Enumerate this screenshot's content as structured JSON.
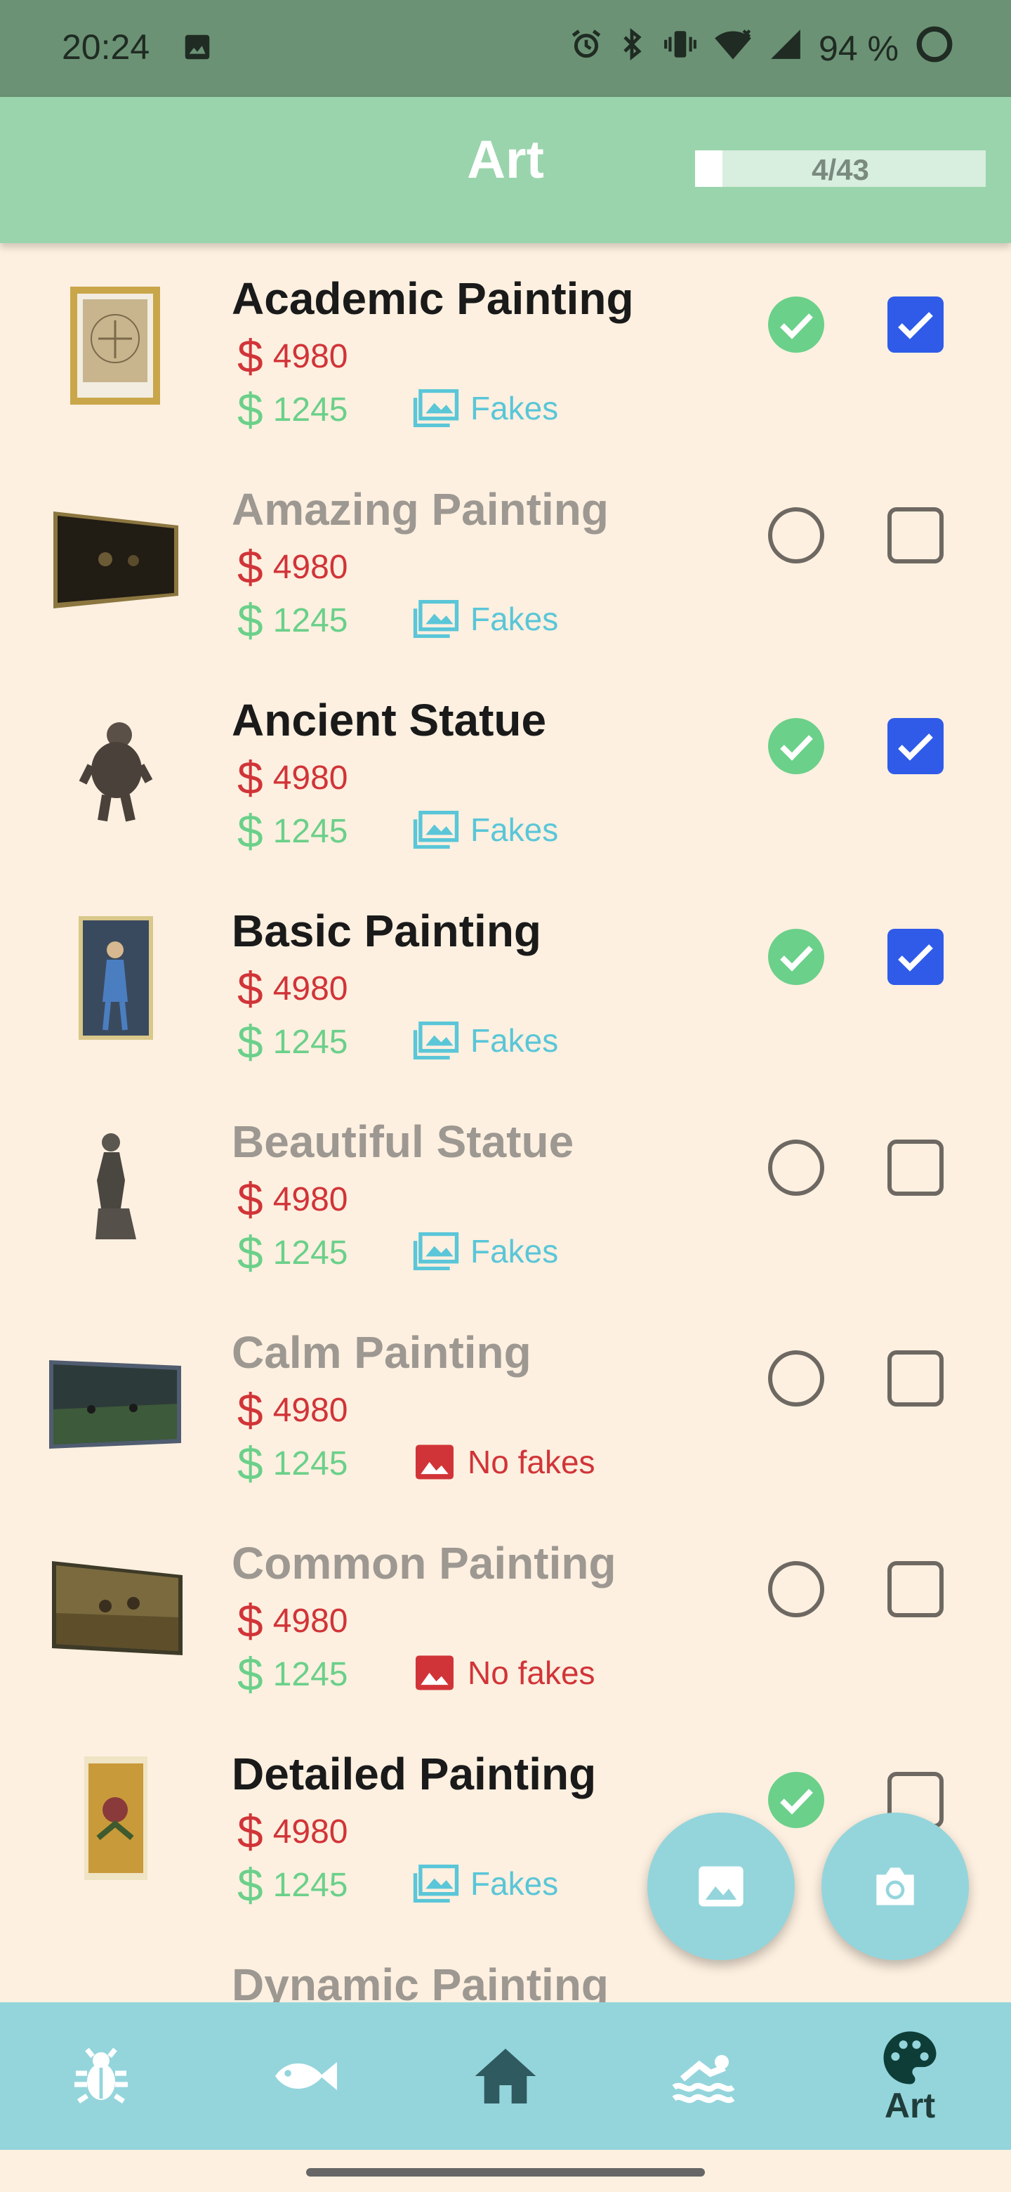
{
  "status_bar": {
    "time": "20:24",
    "battery": "94 %"
  },
  "app_bar": {
    "title": "Art",
    "progress_label": "4/43",
    "progress_fraction": 0.093
  },
  "items": [
    {
      "name": "Academic Painting",
      "buy": "4980",
      "sell": "1245",
      "fakes": "Fakes",
      "has_fakes": true,
      "donated": true,
      "collected": true
    },
    {
      "name": "Amazing Painting",
      "buy": "4980",
      "sell": "1245",
      "fakes": "Fakes",
      "has_fakes": true,
      "donated": false,
      "collected": false
    },
    {
      "name": "Ancient Statue",
      "buy": "4980",
      "sell": "1245",
      "fakes": "Fakes",
      "has_fakes": true,
      "donated": true,
      "collected": true
    },
    {
      "name": "Basic Painting",
      "buy": "4980",
      "sell": "1245",
      "fakes": "Fakes",
      "has_fakes": true,
      "donated": true,
      "collected": true
    },
    {
      "name": "Beautiful Statue",
      "buy": "4980",
      "sell": "1245",
      "fakes": "Fakes",
      "has_fakes": true,
      "donated": false,
      "collected": false
    },
    {
      "name": "Calm Painting",
      "buy": "4980",
      "sell": "1245",
      "fakes": "No fakes",
      "has_fakes": false,
      "donated": false,
      "collected": false
    },
    {
      "name": "Common Painting",
      "buy": "4980",
      "sell": "1245",
      "fakes": "No fakes",
      "has_fakes": false,
      "donated": false,
      "collected": false
    },
    {
      "name": "Detailed Painting",
      "buy": "4980",
      "sell": "1245",
      "fakes": "Fakes",
      "has_fakes": true,
      "donated": true,
      "collected": false
    },
    {
      "name": "Dynamic Painting",
      "buy": "",
      "sell": "",
      "fakes": "",
      "has_fakes": true,
      "donated": false,
      "collected": false
    }
  ],
  "currency_symbol": "$",
  "bottom_nav": {
    "active_label": "Art"
  },
  "colors": {
    "accent_green": "#6bd08a",
    "check_blue": "#2f5be8",
    "price_red": "#d13438",
    "fakes_teal": "#5ac6d8",
    "appbar": "#9ad4ac",
    "navbar": "#94d5dc"
  }
}
